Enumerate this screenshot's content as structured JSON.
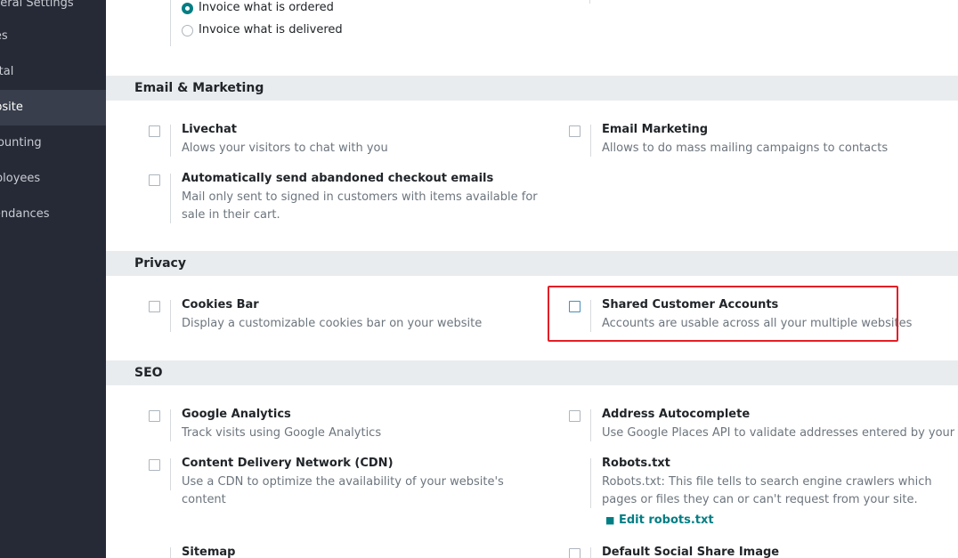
{
  "sidebar": {
    "items": [
      {
        "label": "General Settings"
      },
      {
        "label": "Sales"
      },
      {
        "label": "Rental"
      },
      {
        "label": "Website"
      },
      {
        "label": "Accounting"
      },
      {
        "label": "Employees"
      },
      {
        "label": "Attendances"
      }
    ]
  },
  "invoicing": {
    "options": [
      {
        "label": "Invoice what is ordered",
        "selected": true
      },
      {
        "label": "Invoice what is delivered",
        "selected": false
      }
    ]
  },
  "email_marketing": {
    "header": "Email & Marketing",
    "livechat": {
      "title": "Livechat",
      "desc": "Alows your visitors to chat with you"
    },
    "email_marketing": {
      "title": "Email Marketing",
      "desc": "Allows to do mass mailing campaigns to contacts"
    },
    "abandoned": {
      "title": "Automatically send abandoned checkout emails",
      "desc": "Mail only sent to signed in customers with items available for sale in their cart."
    }
  },
  "privacy": {
    "header": "Privacy",
    "cookies": {
      "title": "Cookies Bar",
      "desc": "Display a customizable cookies bar on your website"
    },
    "shared": {
      "title": "Shared Customer Accounts",
      "desc": "Accounts are usable across all your multiple websites"
    }
  },
  "seo": {
    "header": "SEO",
    "analytics": {
      "title": "Google Analytics",
      "desc": "Track visits using Google Analytics"
    },
    "address": {
      "title": "Address Autocomplete",
      "desc": "Use Google Places API to validate addresses entered by your visitors"
    },
    "cdn": {
      "title": "Content Delivery Network (CDN)",
      "desc": "Use a CDN to optimize the availability of your website's content"
    },
    "robots": {
      "title": "Robots.txt",
      "desc": "Robots.txt: This file tells to search engine crawlers which pages or files they can or can't request from your site.",
      "link": "Edit robots.txt"
    },
    "sitemap": {
      "title": "Sitemap"
    },
    "social": {
      "title": "Default Social Share Image"
    }
  },
  "colors": {
    "accent": "#017e84",
    "highlight": "#e41e26",
    "sidebar_bg": "#262a36"
  }
}
